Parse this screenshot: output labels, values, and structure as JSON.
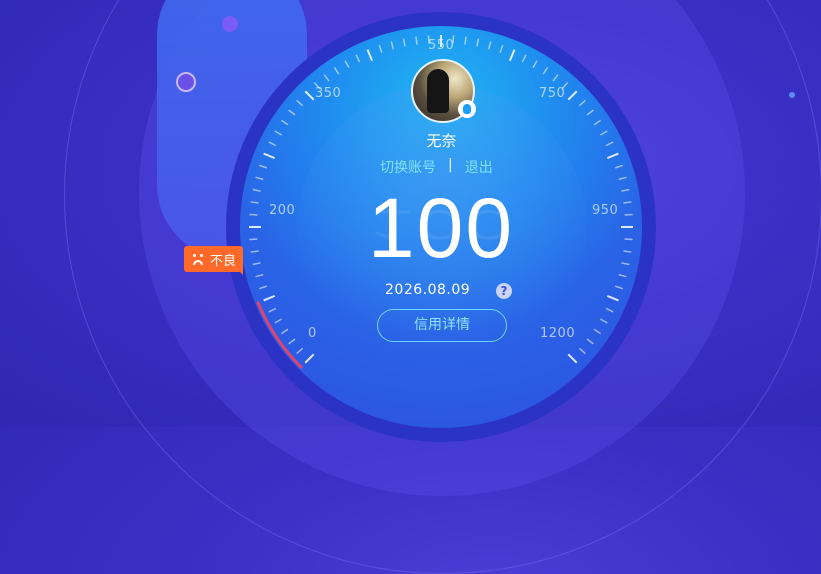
{
  "user": {
    "name": "无奈",
    "switch_account_label": "切换账号",
    "separator": "|",
    "logout_label": "退出"
  },
  "credit": {
    "score": "100",
    "date": "2026.08.09",
    "help_symbol": "?",
    "detail_button_label": "信用详情",
    "rating_label": "不良",
    "rating_color": "#ff6a2a"
  },
  "gauge": {
    "scale_labels": [
      "0",
      "200",
      "350",
      "550",
      "750",
      "950",
      "1200"
    ],
    "min": 0,
    "max": 1200,
    "value": 100,
    "track_color": "#ffffff",
    "progress_color": "#e0436e"
  },
  "icons": {
    "avatar": "user-avatar",
    "badge": "qq-icon",
    "rating": "sad-face-icon",
    "help": "question-icon"
  }
}
